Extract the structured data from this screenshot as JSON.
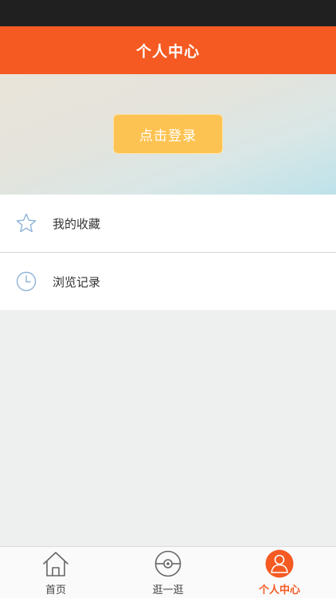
{
  "header": {
    "title": "个人中心"
  },
  "banner": {
    "login_label": "点击登录"
  },
  "menu": {
    "items": [
      {
        "label": "我的收藏",
        "icon": "star-icon"
      },
      {
        "label": "浏览记录",
        "icon": "clock-icon"
      }
    ]
  },
  "tabbar": {
    "tabs": [
      {
        "label": "首页",
        "icon": "home-icon",
        "active": false
      },
      {
        "label": "逛一逛",
        "icon": "browse-ball-icon",
        "active": false
      },
      {
        "label": "个人中心",
        "icon": "user-icon",
        "active": true
      }
    ]
  },
  "colors": {
    "accent": "#f45a22",
    "login_button": "#fdc352",
    "icon_blue": "#8fb3d9",
    "background": "#edf0ef"
  }
}
